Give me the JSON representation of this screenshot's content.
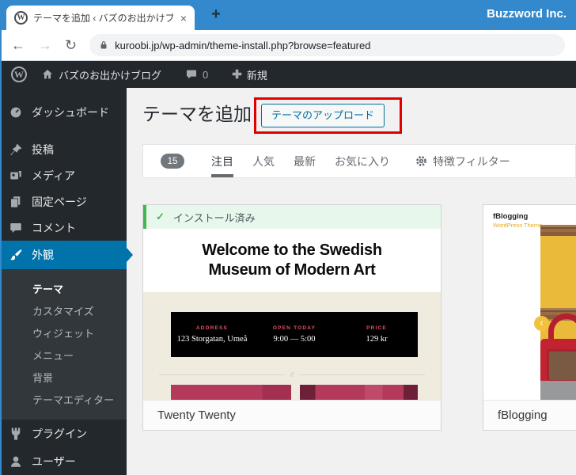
{
  "browser": {
    "tab": {
      "title": "テーマを追加 ‹ バズのお出かけブログ —",
      "close": "×",
      "favicon": "W"
    },
    "new_tab": "+",
    "window_label": "Buzzword Inc.",
    "nav": {
      "back": "←",
      "forward": "→",
      "reload": "↻"
    },
    "url": "kuroobi.jp/wp-admin/theme-install.php?browse=featured"
  },
  "admin_bar": {
    "logo": "W",
    "site_name": "バズのお出かけブログ",
    "comments_count": "0",
    "new_item": "新規"
  },
  "sidebar": {
    "items": [
      {
        "label": "ダッシュボード",
        "icon": "dashboard-icon"
      },
      {
        "label": "投稿",
        "icon": "pin-icon"
      },
      {
        "label": "メディア",
        "icon": "media-icon"
      },
      {
        "label": "固定ページ",
        "icon": "pages-icon"
      },
      {
        "label": "コメント",
        "icon": "comment-icon"
      },
      {
        "label": "外観",
        "icon": "brush-icon",
        "active": true
      },
      {
        "label": "プラグイン",
        "icon": "plug-icon"
      },
      {
        "label": "ユーザー",
        "icon": "user-icon"
      }
    ],
    "appearance_submenu": [
      {
        "label": "テーマ",
        "current": true
      },
      {
        "label": "カスタマイズ"
      },
      {
        "label": "ウィジェット"
      },
      {
        "label": "メニュー"
      },
      {
        "label": "背景"
      },
      {
        "label": "テーマエディター"
      }
    ]
  },
  "main": {
    "page_title": "テーマを追加",
    "upload_button": "テーマのアップロード",
    "filter_bar": {
      "theme_count": "15",
      "tabs": [
        {
          "label": "注目",
          "active": true
        },
        {
          "label": "人気"
        },
        {
          "label": "最新"
        },
        {
          "label": "お気に入り"
        }
      ],
      "feature_filter_label": "特徴フィルター"
    },
    "themes": [
      {
        "name": "Twenty Twenty",
        "installed_badge": "インストール済み",
        "installed_check": "✓",
        "preview_heading": "Welcome to the Swedish Museum of Modern Art",
        "info_panel": [
          {
            "label": "ADDRESS",
            "value": "123 Storgatan, Umeå"
          },
          {
            "label": "OPEN TODAY",
            "value": "9:00 — 5:00"
          },
          {
            "label": "PRICE",
            "value": "129 kr"
          }
        ],
        "divider_glyph": "//"
      },
      {
        "name": "fBlogging",
        "preview_logo": "fBlogging",
        "preview_tagline": "WordPress Theme",
        "carousel_prev": "‹"
      }
    ]
  },
  "annotation": {
    "highlight_color": "#e00000"
  },
  "colors": {
    "titlebar_blue": "#3389cb",
    "admin_dark": "#23282d",
    "wp_blue": "#0073aa",
    "success_green": "#46b450"
  }
}
